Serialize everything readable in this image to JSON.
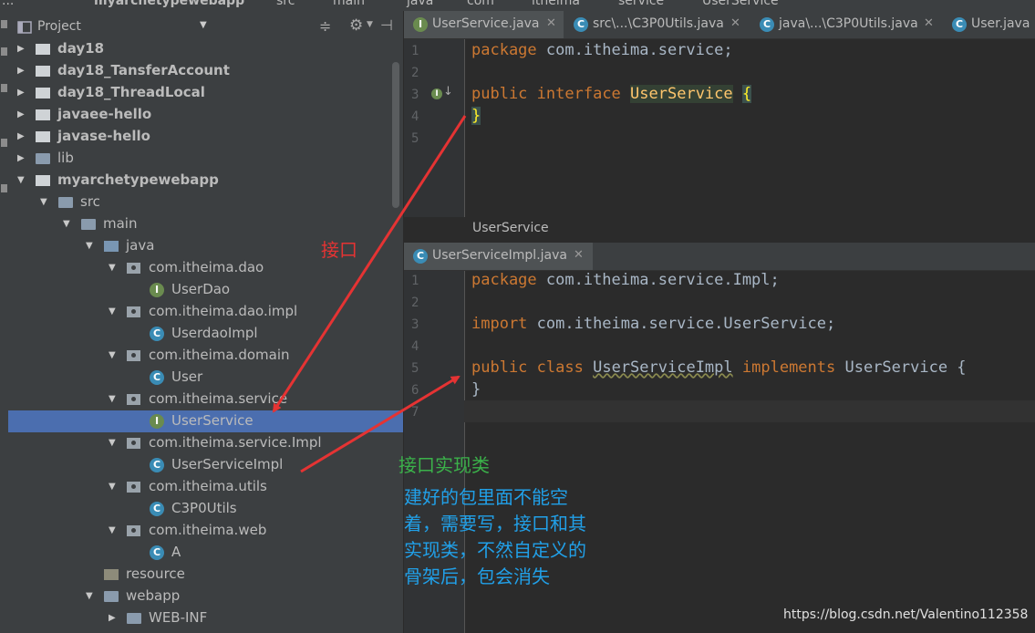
{
  "breadcrumb": [
    "...",
    "myarchetypewebapp",
    "src",
    "main",
    "java",
    "com",
    "itheima",
    "service",
    "UserService"
  ],
  "project_panel": {
    "title": "Project",
    "dropdown_icon": "chevron-down-icon",
    "actions": [
      "collapse-icon",
      "gear-icon",
      "hide-icon"
    ]
  },
  "tree": [
    {
      "label": "day18",
      "depth": 0,
      "arrow": "▶",
      "icon": "proj-folder",
      "bold": true
    },
    {
      "label": "day18_TansferAccount",
      "depth": 0,
      "arrow": "▶",
      "icon": "proj-folder",
      "bold": true
    },
    {
      "label": "day18_ThreadLocal",
      "depth": 0,
      "arrow": "▶",
      "icon": "proj-folder",
      "bold": true
    },
    {
      "label": "javaee-hello",
      "depth": 0,
      "arrow": "▶",
      "icon": "proj-folder",
      "bold": true
    },
    {
      "label": "javase-hello",
      "depth": 0,
      "arrow": "▶",
      "icon": "proj-folder",
      "bold": true
    },
    {
      "label": "lib",
      "depth": 0,
      "arrow": "▶",
      "icon": "folder",
      "bold": false
    },
    {
      "label": "myarchetypewebapp",
      "depth": 0,
      "arrow": "▼",
      "icon": "proj-folder",
      "bold": true
    },
    {
      "label": "src",
      "depth": 1,
      "arrow": "▼",
      "icon": "folder",
      "bold": false
    },
    {
      "label": "main",
      "depth": 2,
      "arrow": "▼",
      "icon": "folder",
      "bold": false
    },
    {
      "label": "java",
      "depth": 3,
      "arrow": "▼",
      "icon": "src",
      "bold": false
    },
    {
      "label": "com.itheima.dao",
      "depth": 4,
      "arrow": "▼",
      "icon": "pkg",
      "bold": false
    },
    {
      "label": "UserDao",
      "depth": 5,
      "arrow": "",
      "icon": "intf",
      "bold": false
    },
    {
      "label": "com.itheima.dao.impl",
      "depth": 4,
      "arrow": "▼",
      "icon": "pkg",
      "bold": false
    },
    {
      "label": "UserdaoImpl",
      "depth": 5,
      "arrow": "",
      "icon": "cls",
      "bold": false
    },
    {
      "label": "com.itheima.domain",
      "depth": 4,
      "arrow": "▼",
      "icon": "pkg",
      "bold": false
    },
    {
      "label": "User",
      "depth": 5,
      "arrow": "",
      "icon": "cls",
      "bold": false
    },
    {
      "label": "com.itheima.service",
      "depth": 4,
      "arrow": "▼",
      "icon": "pkg",
      "bold": false
    },
    {
      "label": "UserService",
      "depth": 5,
      "arrow": "",
      "icon": "intf",
      "bold": false,
      "selected": true
    },
    {
      "label": "com.itheima.service.Impl",
      "depth": 4,
      "arrow": "▼",
      "icon": "pkg",
      "bold": false
    },
    {
      "label": "UserServiceImpl",
      "depth": 5,
      "arrow": "",
      "icon": "cls",
      "bold": false
    },
    {
      "label": "com.itheima.utils",
      "depth": 4,
      "arrow": "▼",
      "icon": "pkg",
      "bold": false
    },
    {
      "label": "C3P0Utils",
      "depth": 5,
      "arrow": "",
      "icon": "cls",
      "bold": false
    },
    {
      "label": "com.itheima.web",
      "depth": 4,
      "arrow": "▼",
      "icon": "pkg",
      "bold": false
    },
    {
      "label": "A",
      "depth": 5,
      "arrow": "",
      "icon": "cls",
      "bold": false
    },
    {
      "label": "resource",
      "depth": 3,
      "arrow": "",
      "icon": "res",
      "bold": false
    },
    {
      "label": "webapp",
      "depth": 3,
      "arrow": "▼",
      "icon": "folder",
      "bold": false
    },
    {
      "label": "WEB-INF",
      "depth": 4,
      "arrow": "▶",
      "icon": "folder",
      "bold": false
    }
  ],
  "tabs_top": [
    {
      "label": "UserService.java",
      "icon": "I",
      "active": true
    },
    {
      "label": "src\\...\\C3P0Utils.java",
      "icon": "C",
      "active": false
    },
    {
      "label": "java\\...\\C3P0Utils.java",
      "icon": "C",
      "active": false
    },
    {
      "label": "User.java",
      "icon": "C",
      "active": false
    }
  ],
  "editor_top": {
    "line_numbers": [
      "1",
      "2",
      "3",
      "4",
      "5"
    ],
    "breadcrumb": "UserService"
  },
  "tabs_bottom": [
    {
      "label": "UserServiceImpl.java",
      "icon": "C",
      "active": true
    }
  ],
  "editor_bottom": {
    "line_numbers": [
      "1",
      "2",
      "3",
      "4",
      "5",
      "6",
      "7"
    ]
  },
  "code_top": {
    "l1_kw": "package",
    "l1_rest": " com.itheima.service;",
    "l3_kw1": "public",
    "l3_kw2": "interface",
    "l3_name": "UserService",
    "l3_brace": "{",
    "l4_brace": "}"
  },
  "code_bottom": {
    "l1_kw": "package",
    "l1_rest": " com.itheima.service.Impl;",
    "l3_kw": "import",
    "l3_rest": " com.itheima.service.UserService;",
    "l5_kw1": "public",
    "l5_kw2": "class",
    "l5_name": "UserServiceImpl",
    "l5_kw3": "implements",
    "l5_rest": " UserService {",
    "l6": "}"
  },
  "annotations": {
    "interface": "接口",
    "impl_class": "接口实现类",
    "note": "建好的包里面不能空\n着，需要写，接口和其\n实现类，不然自定义的\n骨架后，包会消失"
  },
  "watermark": "https://blog.csdn.net/Valentino112358",
  "colors": {
    "keyword": "#cc7832",
    "type": "#ffc66d",
    "selection": "#4b6eaf",
    "annotation_red": "#e53333",
    "annotation_green": "#3bb24a",
    "annotation_blue": "#21a0e8"
  }
}
